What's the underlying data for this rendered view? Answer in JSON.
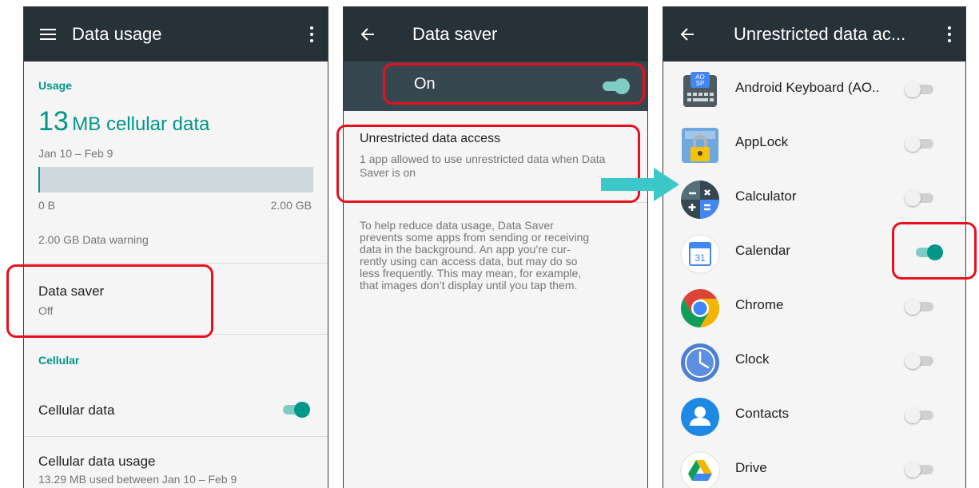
{
  "screen1": {
    "title": "Data usage",
    "usage_label": "Usage",
    "usage_value": "13",
    "usage_unit": "MB cellular data",
    "period": "Jan 10 – Feb 9",
    "bar_min": "0 B",
    "bar_max": "2.00 GB",
    "warning": "2.00 GB Data warning",
    "data_saver_title": "Data saver",
    "data_saver_status": "Off",
    "cellular_label": "Cellular",
    "cellular_data": "Cellular data",
    "cellular_data_on": true,
    "cellular_usage_title": "Cellular data usage",
    "cellular_usage_sub": "13.29 MB used between Jan 10 – Feb 9"
  },
  "screen2": {
    "title": "Data saver",
    "toggle_label": "On",
    "unrestricted_title": "Unrestricted data access",
    "unrestricted_sub": "1 app allowed to use unrestricted data when Data Saver is on",
    "info_lines": [
      "To help reduce data usage, Data Saver",
      "prevents some apps from sending or receiving",
      "data in the background. An app you’re cur-",
      "rently using can access data, but may do so",
      "less frequently. This may mean, for example,",
      "that images don’t display until you tap them."
    ]
  },
  "screen3": {
    "title": "Unrestricted data ac...",
    "apps": [
      {
        "name": "Android Keyboard (AO..",
        "on": false,
        "icon": "android-keyboard-icon"
      },
      {
        "name": "AppLock",
        "on": false,
        "icon": "applock-icon"
      },
      {
        "name": "Calculator",
        "on": false,
        "icon": "calculator-icon"
      },
      {
        "name": "Calendar",
        "on": true,
        "icon": "calendar-icon"
      },
      {
        "name": "Chrome",
        "on": false,
        "icon": "chrome-icon"
      },
      {
        "name": "Clock",
        "on": false,
        "icon": "clock-icon"
      },
      {
        "name": "Contacts",
        "on": false,
        "icon": "contacts-icon"
      },
      {
        "name": "Drive",
        "on": false,
        "icon": "drive-icon"
      }
    ],
    "keyboard_icon_text": "AO SP",
    "calendar_icon_text": "31"
  },
  "colors": {
    "appbar": "#263238",
    "accent": "#009688",
    "highlight": "#e8101f",
    "arrow": "#3cc8c8"
  }
}
